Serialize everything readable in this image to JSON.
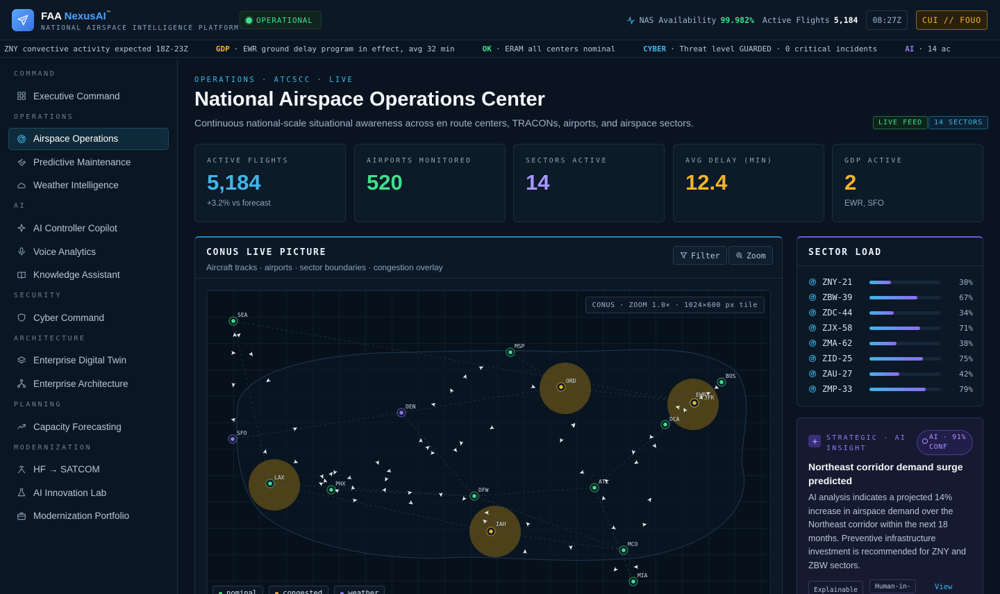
{
  "app": {
    "brand_prefix": "FAA",
    "brand_accent": "NexusAI",
    "trademark": "™",
    "subtitle": "NATIONAL AIRSPACE INTELLIGENCE PLATFORM",
    "status": "OPERATIONAL"
  },
  "topbar": {
    "nas_label": "NAS Availability",
    "nas_value": "99.982%",
    "flights_label": "Active Flights",
    "flights_value": "5,184",
    "clock": "08:27Z",
    "classification": "CUI // FOUO"
  },
  "ticker": [
    {
      "tag": "",
      "text": "ZNY convective activity expected 18Z-23Z",
      "color": "#b7c6d6"
    },
    {
      "tag": "GDP",
      "text": "· EWR ground delay program in effect, avg 32 min",
      "color": "#f0b429"
    },
    {
      "tag": "OK",
      "text": "· ERAM all centers nominal",
      "color": "#3ee08a"
    },
    {
      "tag": "CYBER",
      "text": "· Threat level GUARDED · 0 critical incidents",
      "color": "#3fb6e8"
    },
    {
      "tag": "AI",
      "text": "· 14 ac",
      "color": "#8f7cf0"
    }
  ],
  "sidebar": {
    "sections": [
      {
        "title": "COMMAND",
        "items": [
          {
            "label": "Executive Command",
            "icon": "grid-icon"
          }
        ]
      },
      {
        "title": "OPERATIONS",
        "items": [
          {
            "label": "Airspace Operations",
            "icon": "radar-icon",
            "active": true
          },
          {
            "label": "Predictive Maintenance",
            "icon": "wrench-icon"
          },
          {
            "label": "Weather Intelligence",
            "icon": "cloud-icon"
          }
        ]
      },
      {
        "title": "AI",
        "items": [
          {
            "label": "AI Controller Copilot",
            "icon": "sparkle-icon"
          },
          {
            "label": "Voice Analytics",
            "icon": "mic-icon"
          },
          {
            "label": "Knowledge Assistant",
            "icon": "book-icon"
          }
        ]
      },
      {
        "title": "SECURITY",
        "items": [
          {
            "label": "Cyber Command",
            "icon": "shield-icon"
          }
        ]
      },
      {
        "title": "ARCHITECTURE",
        "items": [
          {
            "label": "Enterprise Digital Twin",
            "icon": "layers-icon"
          },
          {
            "label": "Enterprise Architecture",
            "icon": "network-icon"
          }
        ]
      },
      {
        "title": "PLANNING",
        "items": [
          {
            "label": "Capacity Forecasting",
            "icon": "trend-icon"
          }
        ]
      },
      {
        "title": "MODERNIZATION",
        "items": [
          {
            "label": "HF → SATCOM",
            "icon": "antenna-icon"
          },
          {
            "label": "AI Innovation Lab",
            "icon": "flask-icon"
          },
          {
            "label": "Modernization Portfolio",
            "icon": "briefcase-icon"
          }
        ]
      }
    ]
  },
  "page": {
    "breadcrumb": "OPERATIONS · ATCSCC · LIVE",
    "title": "National Airspace Operations Center",
    "subtitle": "Continuous national-scale situational awareness across en route centers, TRACONs, airports, and airspace sectors.",
    "badge_live": "LIVE FEED",
    "badge_sectors": "14 SECTORS"
  },
  "kpis": [
    {
      "label": "ACTIVE FLIGHTS",
      "value": "5,184",
      "note": "+3.2% vs forecast",
      "color": "#3fb6e8"
    },
    {
      "label": "AIRPORTS MONITORED",
      "value": "520",
      "note": "",
      "color": "#3ee08a"
    },
    {
      "label": "SECTORS ACTIVE",
      "value": "14",
      "note": "",
      "color": "#a797ff"
    },
    {
      "label": "AVG DELAY (MIN)",
      "value": "12.4",
      "note": "",
      "color": "#f0b429"
    },
    {
      "label": "GDP ACTIVE",
      "value": "2",
      "note": "EWR, SFO",
      "color": "#f0b429"
    }
  ],
  "map": {
    "title": "CONUS LIVE PICTURE",
    "subtitle": "Aircraft tracks · airports · sector boundaries · congestion overlay",
    "filter_label": "Filter",
    "zoom_label": "Zoom",
    "tile_tag": "CONUS · ZOOM 1.0× · 1024×600 px tile",
    "legend": [
      {
        "label": "nominal",
        "color": "#3ee08a"
      },
      {
        "label": "congested",
        "color": "#f0b429"
      },
      {
        "label": "weather",
        "color": "#8f7cf0"
      }
    ],
    "airports": [
      {
        "code": "SEA",
        "status": "nominal"
      },
      {
        "code": "MSP",
        "status": "nominal"
      },
      {
        "code": "ORD",
        "status": "congested"
      },
      {
        "code": "BOS",
        "status": "nominal"
      },
      {
        "code": "EWR",
        "status": "nominal"
      },
      {
        "code": "JFK",
        "status": "congested"
      },
      {
        "code": "DCA",
        "status": "nominal"
      },
      {
        "code": "DEN",
        "status": "weather"
      },
      {
        "code": "SFO",
        "status": "weather"
      },
      {
        "code": "LAX",
        "status": "nominal"
      },
      {
        "code": "PHX",
        "status": "nominal"
      },
      {
        "code": "DFW",
        "status": "nominal"
      },
      {
        "code": "ATL",
        "status": "nominal"
      },
      {
        "code": "IAH",
        "status": "congested"
      },
      {
        "code": "MCO",
        "status": "nominal"
      },
      {
        "code": "MIA",
        "status": "nominal"
      }
    ]
  },
  "sector_load": {
    "title": "SECTOR LOAD",
    "rows": [
      {
        "name": "ZNY-21",
        "pct": 30,
        "label": "30%"
      },
      {
        "name": "ZBW-39",
        "pct": 67,
        "label": "67%"
      },
      {
        "name": "ZDC-44",
        "pct": 34,
        "label": "34%"
      },
      {
        "name": "ZJX-58",
        "pct": 71,
        "label": "71%"
      },
      {
        "name": "ZMA-62",
        "pct": 38,
        "label": "38%"
      },
      {
        "name": "ZID-25",
        "pct": 75,
        "label": "75%"
      },
      {
        "name": "ZAU-27",
        "pct": 42,
        "label": "42%"
      },
      {
        "name": "ZMP-33",
        "pct": 79,
        "label": "79%"
      }
    ]
  },
  "insight": {
    "label": "STRATEGIC · AI INSIGHT",
    "confidence": "AI · 91% CONF",
    "title": "Northeast corridor demand surge predicted",
    "body": "AI analysis indicates a projected 14% increase in airspace demand over the Northeast corridor within the next 18 months. Preventive infrastructure investment is recommended for ZNY and ZBW sectors.",
    "tag1": "Explainable",
    "tag2": "Human-in-",
    "link": "View"
  }
}
